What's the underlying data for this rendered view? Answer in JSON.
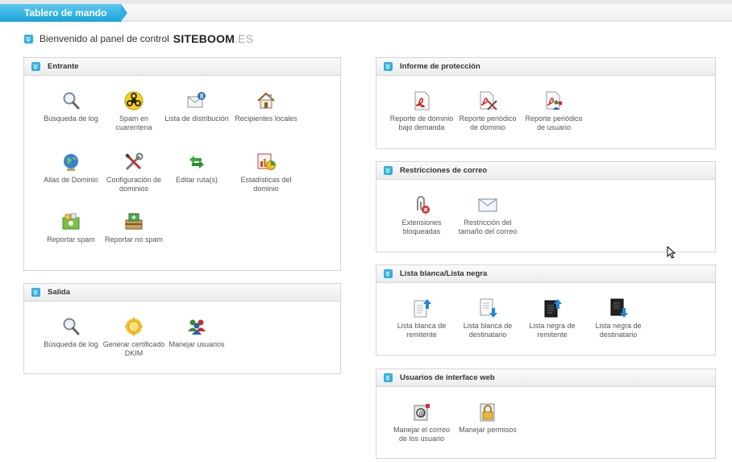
{
  "header": {
    "title": "Tablero de mando"
  },
  "welcome": {
    "text": "Bienvenido al panel de control",
    "logo_main": "SITEBOOM",
    "logo_ext": ".ES"
  },
  "panels": {
    "entrante": {
      "title": "Entrante",
      "items": [
        {
          "label": "Búsqueda de log",
          "icon": "magnifier-icon"
        },
        {
          "label": "Spam en cuarentena",
          "icon": "biohazard-icon"
        },
        {
          "label": "Lista de distribución",
          "icon": "mail-list-icon"
        },
        {
          "label": "Recipientes locales",
          "icon": "house-icon"
        },
        {
          "label": "Alias de Dominio",
          "icon": "globe-icon"
        },
        {
          "label": "Configuración de dominios",
          "icon": "tools-icon"
        },
        {
          "label": "Editar ruta(s)",
          "icon": "arrows-icon"
        },
        {
          "label": "Estadísticas del dominio",
          "icon": "stats-icon"
        },
        {
          "label": "Reportar spam",
          "icon": "report-spam-icon"
        },
        {
          "label": "Reportar no spam",
          "icon": "report-no-spam-icon"
        }
      ]
    },
    "salida": {
      "title": "Salida",
      "items": [
        {
          "label": "Búsqueda de log",
          "icon": "magnifier-icon"
        },
        {
          "label": "Generar certificado DKIM",
          "icon": "certificate-icon"
        },
        {
          "label": "Manejar usuarios",
          "icon": "users-icon"
        }
      ]
    },
    "proteccion": {
      "title": "Informe de protección",
      "items": [
        {
          "label": "Reporte de dominio bajo demanda",
          "icon": "pdf-icon"
        },
        {
          "label": "Reporte periódico de dominio",
          "icon": "pdf-tools-icon"
        },
        {
          "label": "Reporte periódico de usuario",
          "icon": "pdf-user-icon"
        }
      ]
    },
    "restricciones": {
      "title": "Restricciones de correo",
      "items": [
        {
          "label": "Extensiones bloqueadas",
          "icon": "blocked-attachment-icon"
        },
        {
          "label": "Restricción del tamaño del correo",
          "icon": "envelope-icon"
        }
      ]
    },
    "listas": {
      "title": "Lista blanca/Lista negra",
      "items": [
        {
          "label": "Lista blanca de remitente",
          "icon": "whitelist-sender-icon"
        },
        {
          "label": "Lista blanca de destinatario",
          "icon": "whitelist-recipient-icon"
        },
        {
          "label": "Lista negra de remitente",
          "icon": "blacklist-sender-icon"
        },
        {
          "label": "Lista negra de destinatario",
          "icon": "blacklist-recipient-icon"
        }
      ]
    },
    "web": {
      "title": "Usuarios de interface web",
      "items": [
        {
          "label": "Manejar el correo de los usuario",
          "icon": "mail-lock-icon"
        },
        {
          "label": "Manejar permisos",
          "icon": "lock-icon"
        }
      ]
    }
  }
}
